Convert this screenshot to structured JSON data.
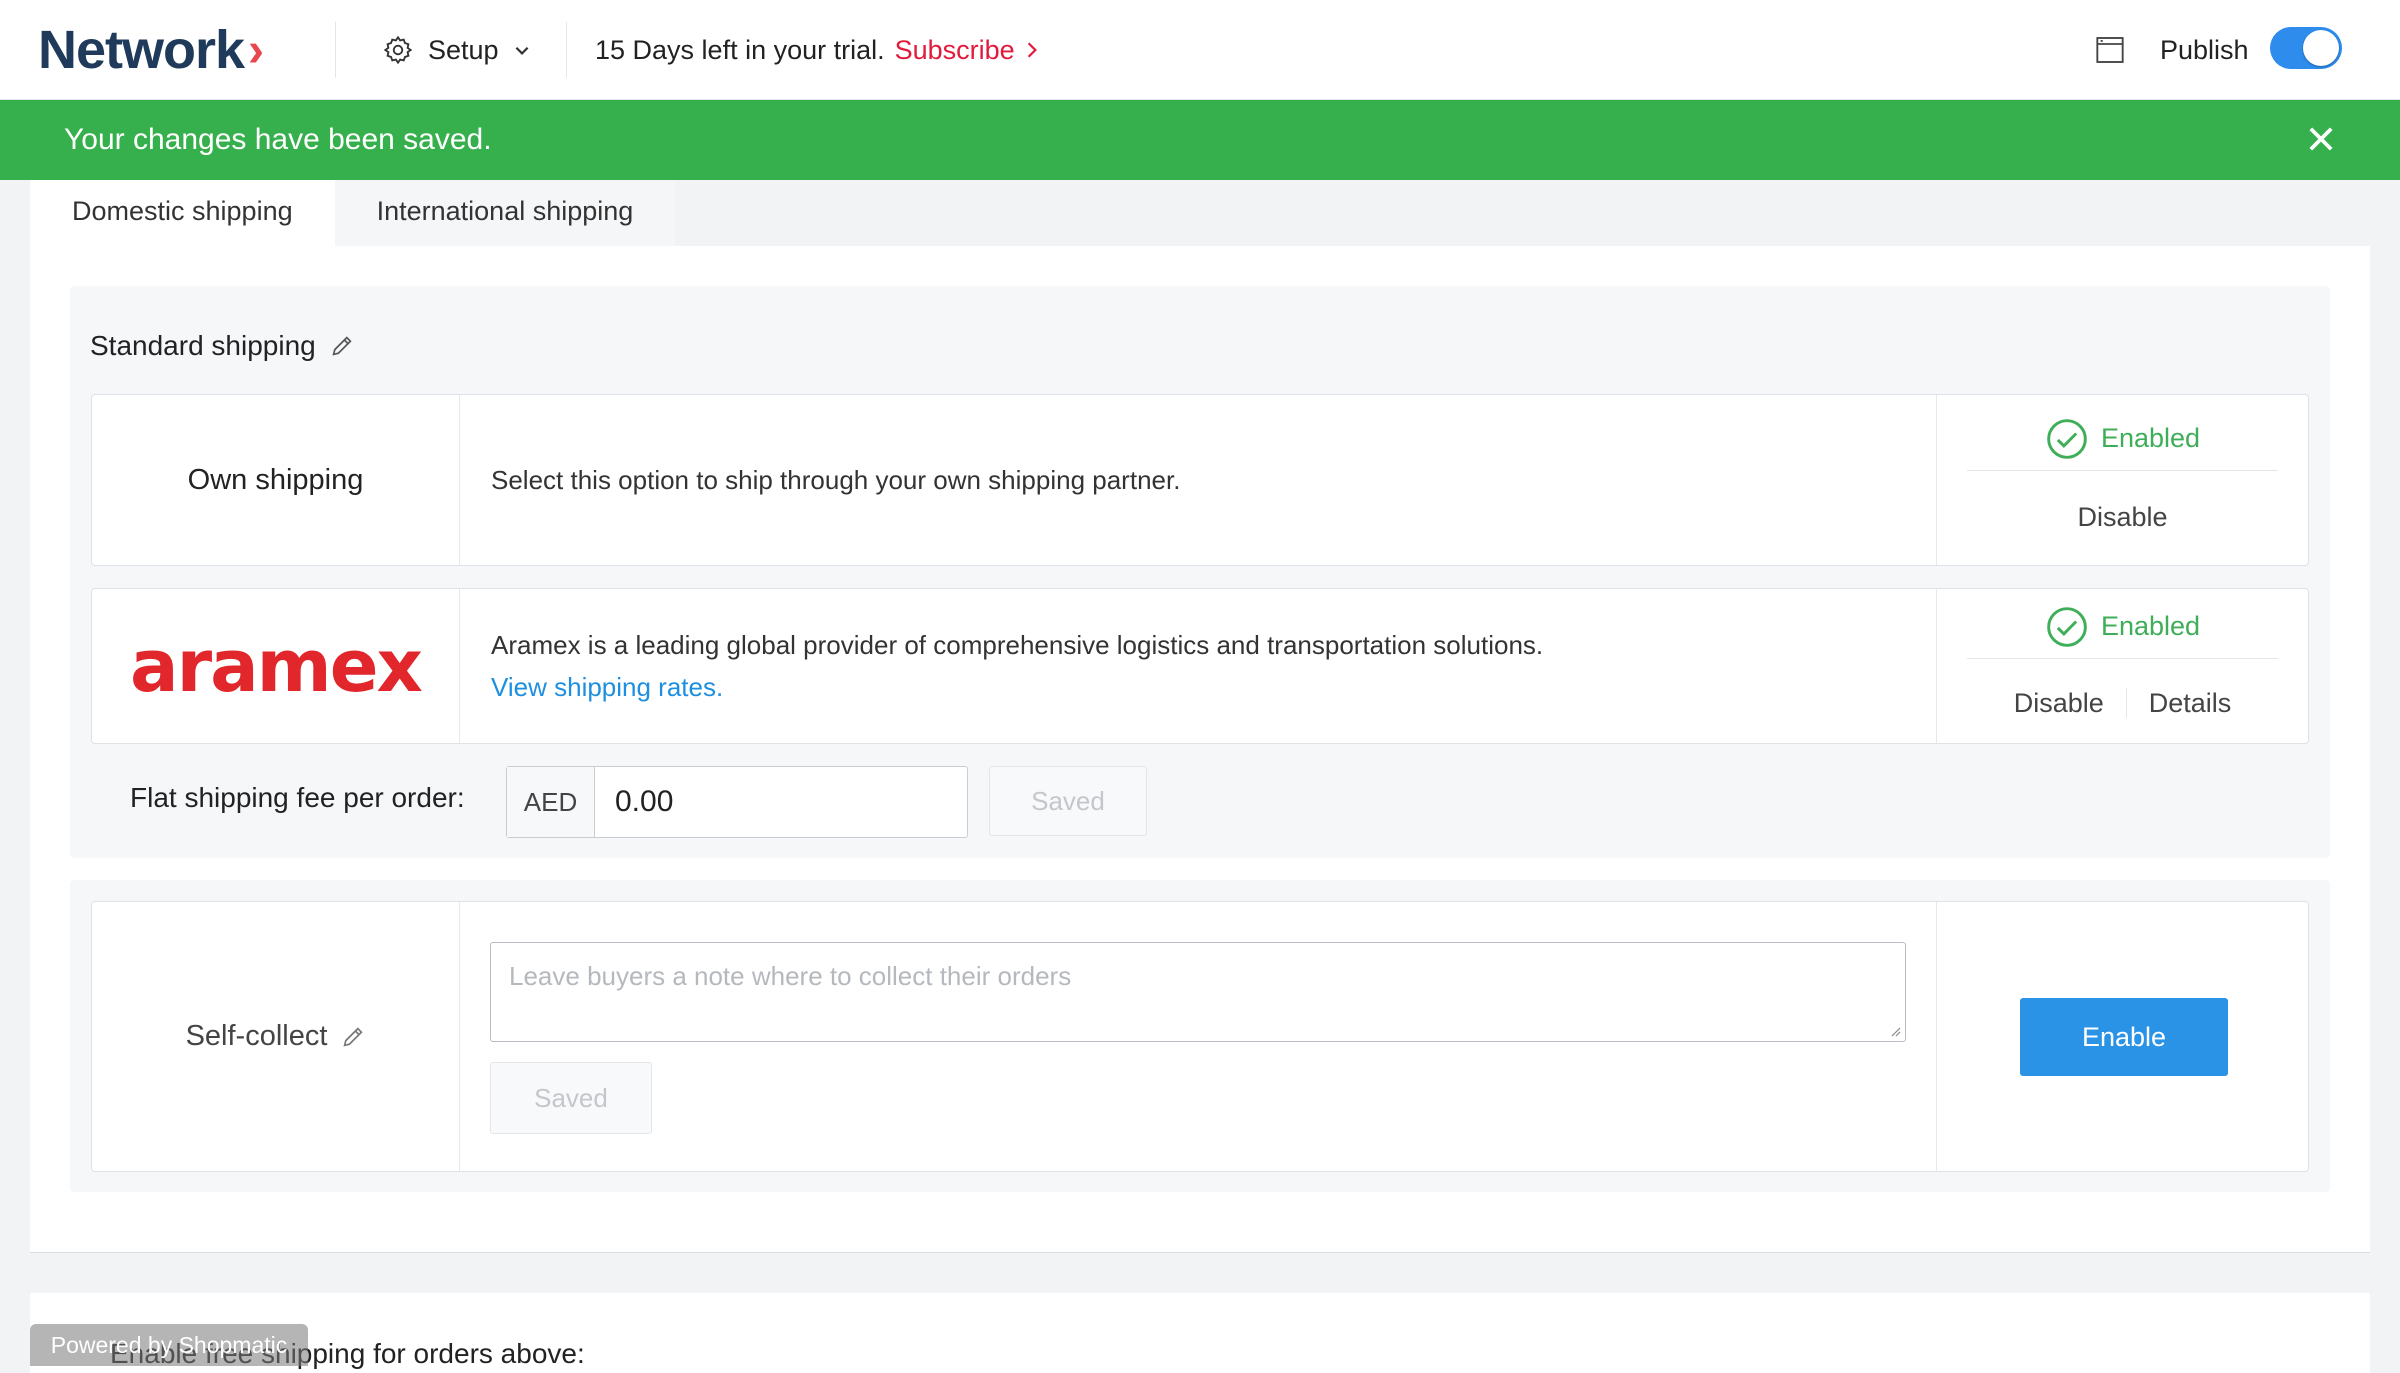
{
  "header": {
    "logo": "Network",
    "logo_chevron": "›",
    "setup_label": "Setup",
    "trial_text": "15 Days left in your trial.",
    "subscribe_label": "Subscribe",
    "publish_label": "Publish",
    "publish_on": true
  },
  "banner": {
    "message": "Your changes have been saved."
  },
  "tabs": [
    {
      "label": "Domestic shipping",
      "active": true
    },
    {
      "label": "International shipping",
      "active": false
    }
  ],
  "standard_shipping": {
    "title": "Standard shipping",
    "own": {
      "name": "Own shipping",
      "description": "Select this option to ship through your own shipping partner.",
      "status": "Enabled",
      "disable_label": "Disable"
    },
    "aramex": {
      "logo": "aramex",
      "description": "Aramex is a leading global provider of comprehensive logistics and transportation solutions.",
      "rates_link": "View shipping rates.",
      "status": "Enabled",
      "disable_label": "Disable",
      "details_label": "Details"
    },
    "flat_fee": {
      "label": "Flat shipping fee per order:",
      "currency": "AED",
      "value": "0.00",
      "save_label": "Saved"
    }
  },
  "self_collect": {
    "name": "Self-collect",
    "placeholder": "Leave buyers a note where to collect their orders",
    "save_label": "Saved",
    "enable_label": "Enable"
  },
  "free_shipping": {
    "label": "Enable free shipping for orders above:"
  },
  "footer": {
    "powered": "Powered by Shopmatic"
  },
  "colors": {
    "brand_navy": "#1f3a5a",
    "banner_green": "#36b04c",
    "accent_blue": "#2a93e6",
    "subscribe_red": "#e01b3c",
    "enabled_green": "#3fae58",
    "aramex_red": "#e1262c"
  }
}
